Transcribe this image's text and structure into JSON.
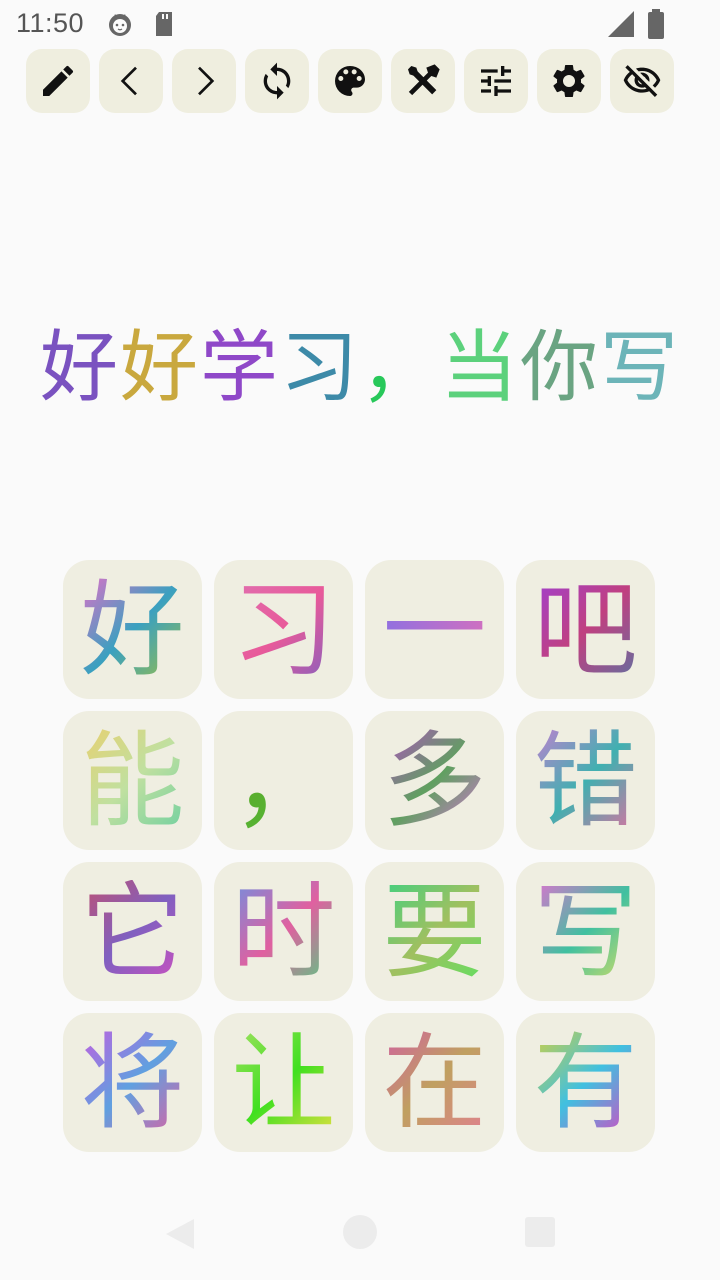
{
  "status_bar": {
    "time": "11:50",
    "icons": [
      "cat-notification-icon",
      "sd-card-icon",
      "signal-icon",
      "battery-icon"
    ]
  },
  "toolbar": {
    "buttons": [
      {
        "icon": "pencil-icon"
      },
      {
        "icon": "chevron-left-icon"
      },
      {
        "icon": "chevron-right-icon"
      },
      {
        "icon": "refresh-icon"
      },
      {
        "icon": "palette-icon"
      },
      {
        "icon": "tools-icon"
      },
      {
        "icon": "sliders-icon"
      },
      {
        "icon": "gear-icon"
      },
      {
        "icon": "eye-off-icon"
      }
    ],
    "button_bg": "#efeedf",
    "icon_color": "#111111"
  },
  "sentence": {
    "chars": [
      "好",
      "好",
      "学",
      "习",
      "，",
      "当",
      "你",
      "写"
    ]
  },
  "grid": {
    "tiles": [
      "好",
      "习",
      "一",
      "吧",
      "能",
      "，",
      "多",
      "错",
      "它",
      "时",
      "要",
      "写",
      "将",
      "让",
      "在",
      "有"
    ],
    "tile_bg": "#efeee1"
  },
  "nav_bar": {
    "icons": [
      "back-triangle-icon",
      "home-circle-icon",
      "recents-square-icon"
    ],
    "color": "#ececec"
  }
}
